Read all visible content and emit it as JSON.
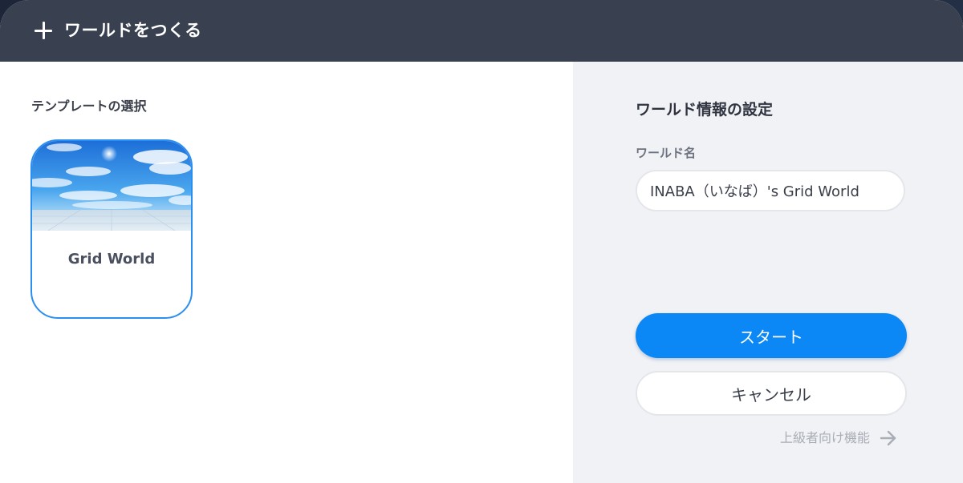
{
  "header": {
    "icon": "plus-icon",
    "title": "ワールドをつくる"
  },
  "templates": {
    "section_label": "テンプレートの選択",
    "items": [
      {
        "name": "Grid World",
        "selected": true
      }
    ]
  },
  "settings": {
    "title": "ワールド情報の設定",
    "world_name_label": "ワールド名",
    "world_name_value": "INABA（いなば）'s Grid World",
    "start_label": "スタート",
    "cancel_label": "キャンセル",
    "advanced_label": "上級者向け機能",
    "advanced_icon": "arrow-right-icon"
  },
  "colors": {
    "header_bg": "#39404f",
    "accent": "#0b88f5",
    "selected_border": "#2a8ff0",
    "right_panel_bg": "#f1f2f5"
  }
}
